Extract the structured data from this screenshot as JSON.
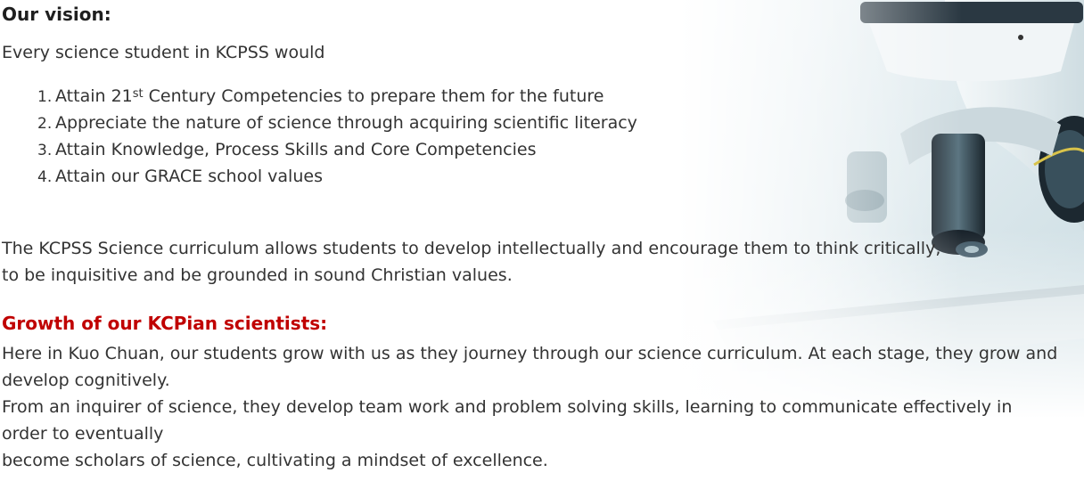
{
  "vision": {
    "heading": "Our vision:",
    "intro": "Every science student in KCPSS would",
    "items": [
      {
        "number": "1.",
        "text_before": "Attain 21",
        "superscript": "st",
        "text_after": " Century Competencies to prepare them for the future"
      },
      {
        "number": "2.",
        "text": "Appreciate the nature of science through acquiring scientific literacy"
      },
      {
        "number": "3.",
        "text": "Attain Knowledge, Process Skills and Core Competencies"
      },
      {
        "number": "4.",
        "text": "Attain our GRACE school values"
      }
    ]
  },
  "curriculum": {
    "line1": "The KCPSS Science curriculum allows students to develop intellectually and encourage them to think critically,",
    "line2": "to be inquisitive and be grounded in sound Christian values."
  },
  "growth": {
    "heading": "Growth of our KCPian scientists:",
    "lines": [
      "Here in Kuo Chuan, our students grow with us as they journey through our science curriculum. At each stage, they grow and develop cognitively.",
      "From an inquirer of science, they develop team work and problem solving skills, learning to communicate effectively in order to eventually",
      "become scholars of science, cultivating a mindset of excellence."
    ]
  },
  "colors": {
    "body_text": "#333333",
    "heading": "#1f1f1f",
    "accent_heading": "#c00000"
  },
  "icons": {
    "hero": "microscope-illustration"
  }
}
